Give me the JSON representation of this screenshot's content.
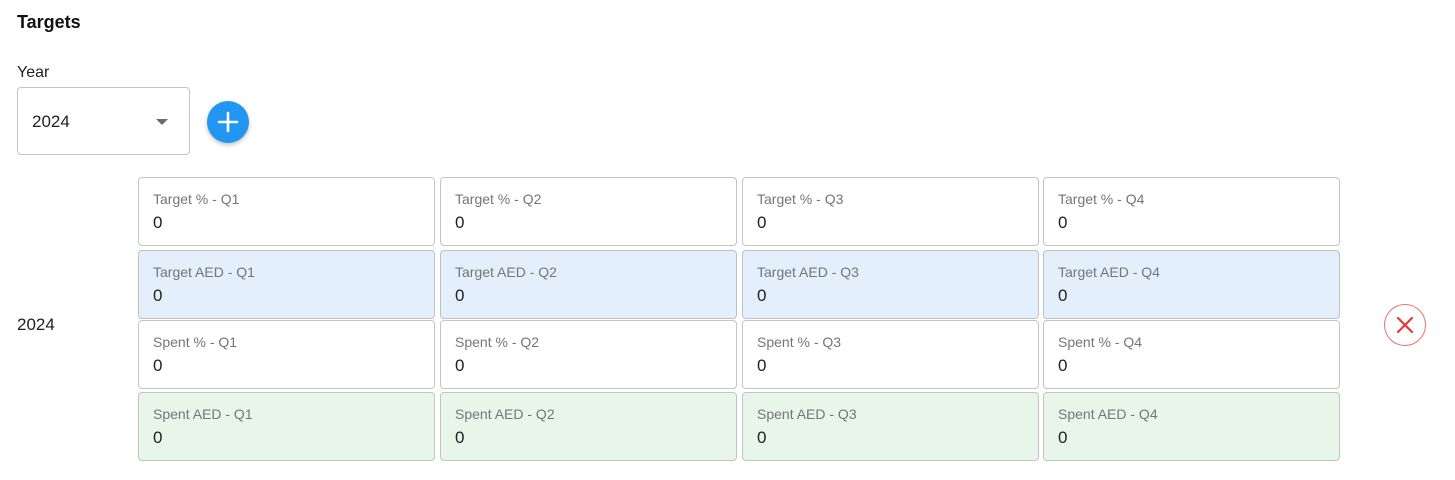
{
  "section": {
    "title": "Targets"
  },
  "year_select": {
    "label": "Year",
    "value": "2024"
  },
  "add_button": {
    "icon": "plus-icon",
    "color": "#2196f3"
  },
  "row": {
    "year": "2024",
    "remove_icon": "close-icon",
    "fields": {
      "target_pct": [
        {
          "label": "Target % - Q1",
          "value": "0"
        },
        {
          "label": "Target % - Q2",
          "value": "0"
        },
        {
          "label": "Target % - Q3",
          "value": "0"
        },
        {
          "label": "Target % - Q4",
          "value": "0"
        }
      ],
      "target_aed": [
        {
          "label": "Target AED - Q1",
          "value": "0"
        },
        {
          "label": "Target AED - Q2",
          "value": "0"
        },
        {
          "label": "Target AED - Q3",
          "value": "0"
        },
        {
          "label": "Target AED - Q4",
          "value": "0"
        }
      ],
      "spent_pct": [
        {
          "label": "Spent % - Q1",
          "value": "0"
        },
        {
          "label": "Spent % - Q2",
          "value": "0"
        },
        {
          "label": "Spent % - Q3",
          "value": "0"
        },
        {
          "label": "Spent % - Q4",
          "value": "0"
        }
      ],
      "spent_aed": [
        {
          "label": "Spent AED - Q1",
          "value": "0"
        },
        {
          "label": "Spent AED - Q2",
          "value": "0"
        },
        {
          "label": "Spent AED - Q3",
          "value": "0"
        },
        {
          "label": "Spent AED - Q4",
          "value": "0"
        }
      ]
    }
  },
  "colors": {
    "target_aed_bg": "#e3f0fb",
    "spent_aed_bg": "#e8f5e9",
    "remove_red": "#e53935"
  }
}
